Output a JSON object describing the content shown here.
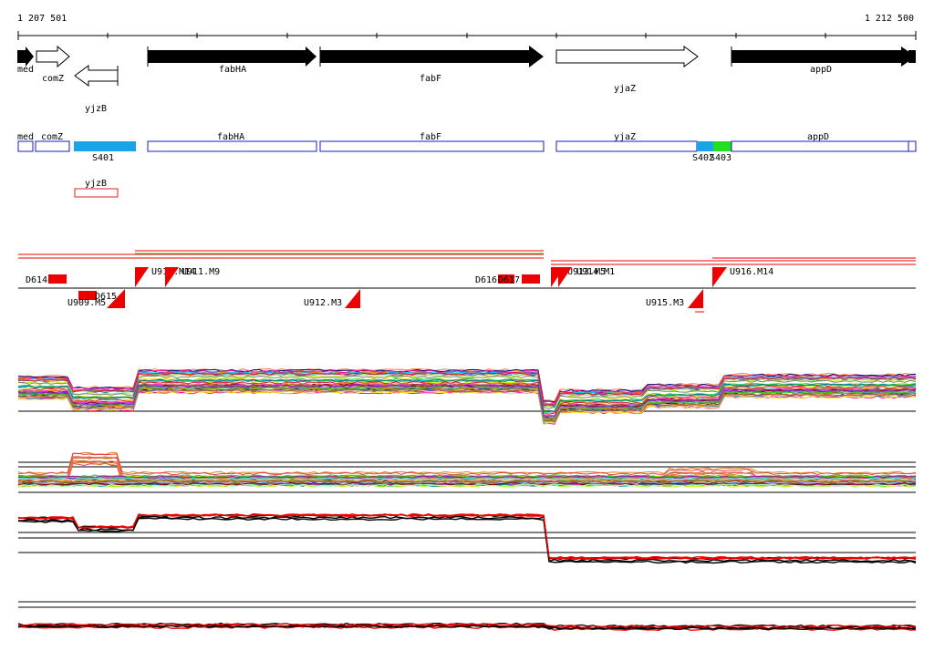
{
  "scale": {
    "start_label": "1 207 501",
    "end_label": "1 212 500"
  },
  "genes": [
    {
      "name": "med",
      "strand": "+",
      "style": "filled"
    },
    {
      "name": "comZ",
      "strand": "+",
      "style": "outline"
    },
    {
      "name": "yjzB",
      "strand": "-",
      "style": "outline"
    },
    {
      "name": "fabHA",
      "strand": "+",
      "style": "filled"
    },
    {
      "name": "fabF",
      "strand": "+",
      "style": "filled"
    },
    {
      "name": "yjaZ",
      "strand": "+",
      "style": "outline"
    },
    {
      "name": "appD",
      "strand": "+",
      "style": "filled"
    }
  ],
  "transcript_labels": [
    "med",
    "comZ",
    "fabHA",
    "fabF",
    "yjaZ",
    "appD",
    "yjzB"
  ],
  "segment_labels": [
    "S401",
    "S402",
    "S403"
  ],
  "colors": {
    "gene_outline": "#1a1acc",
    "segment_S401": "#1aa3e8",
    "segment_S402": "#1aa3e8",
    "segment_S403": "#22dd22",
    "antisense_box": "#dd2222",
    "feature_red": "#ee0000",
    "axis": "#000000",
    "feature_green": "#44cc44"
  },
  "features_upstream": [
    "U910.M14",
    "U911.M9",
    "U913.M5",
    "U914.M1",
    "U916.M14"
  ],
  "features_downstream": [
    "U909.M5",
    "U912.M3",
    "U915.M3"
  ],
  "features_down": [
    "D614",
    "D615",
    "D616",
    "D617"
  ]
}
